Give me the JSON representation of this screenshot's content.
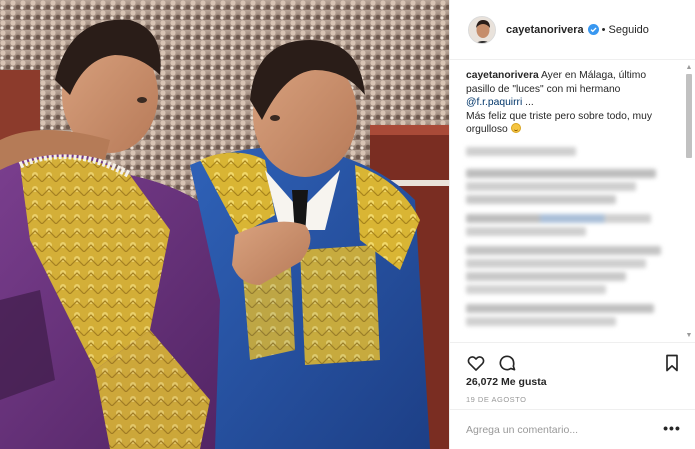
{
  "post": {
    "image_description_icon": "photo",
    "header": {
      "username": "cayetanorivera",
      "verified_icon": "verified-badge-icon",
      "separator": "•",
      "follow_status": "Seguido"
    },
    "caption": {
      "user": "cayetanorivera",
      "text_1": " Ayer en Málaga, último pasillo de \"luces\" con mi hermano ",
      "mention": "@f.r.paquirri",
      "text_2": " ...",
      "text_3": "Más feliz que triste pero sobre todo, muy orgulloso ",
      "emoji_icon": "smiling-face-emoji"
    },
    "actions": {
      "like_icon": "heart-icon",
      "comment_icon": "speech-bubble-icon",
      "save_icon": "bookmark-icon"
    },
    "likes_text": "26,072 Me gusta",
    "date_text": "19 DE AGOSTO",
    "add_comment_placeholder": "Agrega un comentario...",
    "more_options_icon": "ellipsis-icon",
    "colors": {
      "accent_blue": "#3897f0",
      "mention_blue": "#003569",
      "text": "#262626",
      "muted": "#999999",
      "border": "#efefef"
    }
  }
}
